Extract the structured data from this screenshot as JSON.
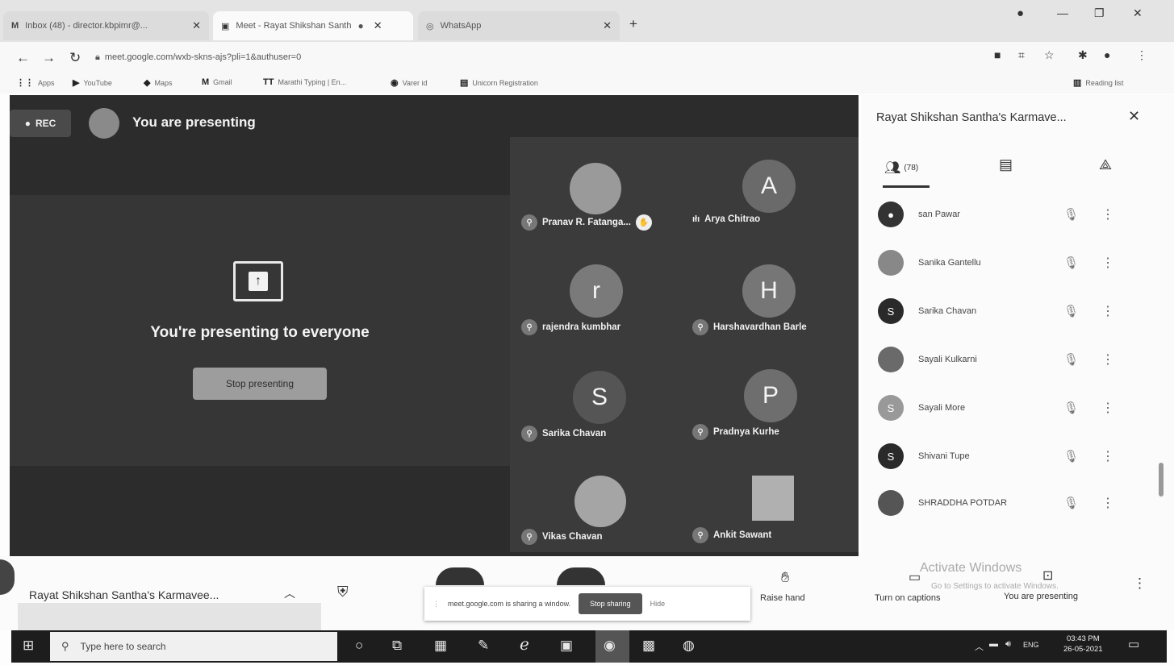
{
  "browser": {
    "tabs": [
      {
        "title": "Inbox (48) - director.kbpimr@...",
        "icon": "gmail-icon",
        "active": false
      },
      {
        "title": "Meet - Rayat Shikshan Santh",
        "icon": "meet-icon",
        "active": true
      },
      {
        "title": "WhatsApp",
        "icon": "whatsapp-icon",
        "active": false
      }
    ],
    "new_tab": "+",
    "url": "meet.google.com/wxb-skns-ajs?pli=1&authuser=0",
    "bookmarks": [
      "Apps",
      "YouTube",
      "Maps",
      "Gmail",
      "Marathi Typing | En...",
      "Varer id",
      "Unicorn Registration"
    ],
    "reading_list": "Reading list"
  },
  "meet": {
    "rec_label": "REC",
    "presenting_banner": "You are presenting",
    "present_message": "You're presenting to everyone",
    "stop_presenting": "Stop presenting",
    "tiles": [
      {
        "name": "Pranav R. Fatanga...",
        "type": "photo"
      },
      {
        "name": "Arya Chitrao",
        "type": "letter",
        "letter": "A"
      },
      {
        "name": "rajendra kumbhar",
        "type": "letter",
        "letter": "r"
      },
      {
        "name": "Harshavardhan Barle",
        "type": "letter",
        "letter": "H"
      },
      {
        "name": "Sarika Chavan",
        "type": "letter",
        "letter": "S"
      },
      {
        "name": "Pradnya Kurhe",
        "type": "letter",
        "letter": "P"
      },
      {
        "name": "Vikas Chavan",
        "type": "photo"
      },
      {
        "name": "Ankit Sawant",
        "type": "photo"
      }
    ]
  },
  "panel": {
    "title": "Rayat Shikshan Santha's Karmave...",
    "people_count": "(78)",
    "participants": [
      {
        "name": "san Pawar",
        "avatar": "photo"
      },
      {
        "name": "Sanika Gantellu",
        "avatar": "photo"
      },
      {
        "name": "Sarika Chavan",
        "avatar": "S"
      },
      {
        "name": "Sayali Kulkarni",
        "avatar": "photo"
      },
      {
        "name": "Sayali More",
        "avatar": "S"
      },
      {
        "name": "Shivani Tupe",
        "avatar": "S"
      },
      {
        "name": "SHRADDHA POTDAR",
        "avatar": "photo"
      }
    ]
  },
  "controls": {
    "meeting_name": "Rayat Shikshan Santha's Karmavee...",
    "sharing_text": "meet.google.com is sharing a window.",
    "stop_sharing": "Stop sharing",
    "hide": "Hide",
    "raise_hand": "Raise hand",
    "captions": "Turn on captions",
    "you_presenting": "You are presenting",
    "activate_title": "Activate Windows",
    "activate_sub": "Go to Settings to activate Windows."
  },
  "taskbar": {
    "search_placeholder": "Type here to search",
    "lang": "ENG",
    "time": "03:43 PM",
    "date": "26-05-2021"
  }
}
